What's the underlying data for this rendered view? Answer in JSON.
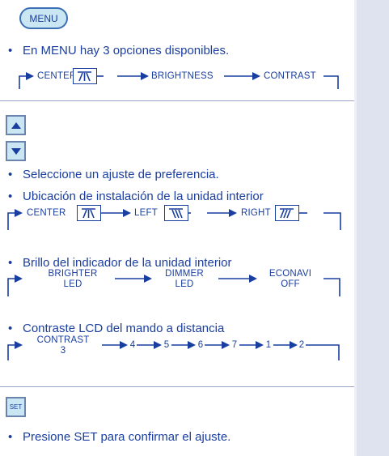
{
  "menu_button": "MENU",
  "bullets": {
    "options": "En MENU hay 3 opciones disponibles.",
    "select": "Seleccione un ajuste de preferencia.",
    "location": "Ubicación de instalación de la unidad interior",
    "brightness": "Brillo del indicador de la unidad interior",
    "contrast": "Contraste LCD del mando a distancia",
    "confirm": "Presione SET para confirmar el ajuste."
  },
  "bullet_symbol": "•",
  "flow_menu": [
    "CENTER",
    "BRIGHTNESS",
    "CONTRAST"
  ],
  "flow_location": [
    "CENTER",
    "LEFT",
    "RIGHT"
  ],
  "flow_brightness": [
    {
      "line1": "BRIGHTER",
      "line2": "LED"
    },
    {
      "line1": "DIMMER",
      "line2": "LED"
    },
    {
      "line1": "ECONAVI",
      "line2": "OFF"
    }
  ],
  "flow_contrast": {
    "first": {
      "line1": "CONTRAST",
      "line2": "3"
    },
    "steps": [
      "4",
      "5",
      "6",
      "7",
      "1",
      "2"
    ]
  },
  "set_button": "SET",
  "up_icon": "triangle-up-icon",
  "down_icon": "triangle-down-icon",
  "colors": {
    "text": "#1a3ea0",
    "button_fill": "#c9e6f2",
    "sidebar": "#dfe3ef"
  }
}
